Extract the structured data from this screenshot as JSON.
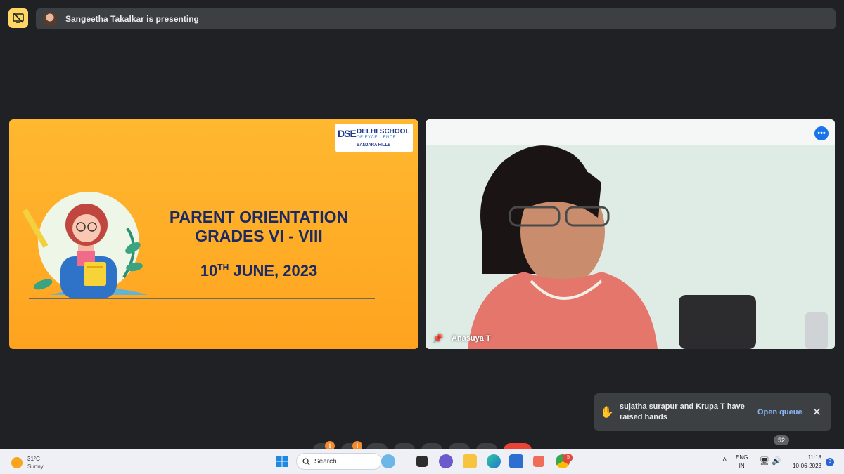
{
  "header": {
    "presenting_text": "Sangeetha Takalkar is presenting"
  },
  "slide": {
    "logo_mark": "DSE",
    "logo_name": "DELHI SCHOOL",
    "logo_sub": "OF EXCELLENCE",
    "logo_place": "BANJARA HILLS",
    "title_line1": "PARENT ORIENTATION",
    "title_line2": "GRADES VI - VIII",
    "date_day": "10",
    "date_suffix": "TH",
    "date_rest": " JUNE, 2023"
  },
  "camera": {
    "participant_name": "Anasuya T",
    "more_label": "•••"
  },
  "toast": {
    "message": "sujatha surapur and Krupa T have raised hands",
    "action_label": "Open queue",
    "close_label": "✕"
  },
  "controls": {
    "badge_1": "!",
    "badge_2": "!",
    "participant_count": "52"
  },
  "taskbar": {
    "temperature": "31°C",
    "condition": "Sunny",
    "search_label": "Search",
    "lang_1": "ENG",
    "lang_2": "IN",
    "time": "11:18",
    "date": "10-06-2023",
    "notification_count": "3",
    "chrome_badge": "5"
  },
  "colors": {
    "meet_bg": "#202124",
    "slide_orange": "#ffa31f",
    "slide_text": "#1b2a63",
    "accent_blue": "#1a73e8",
    "end_call_red": "#ea4335",
    "presenting_yellow": "#fdd663"
  }
}
